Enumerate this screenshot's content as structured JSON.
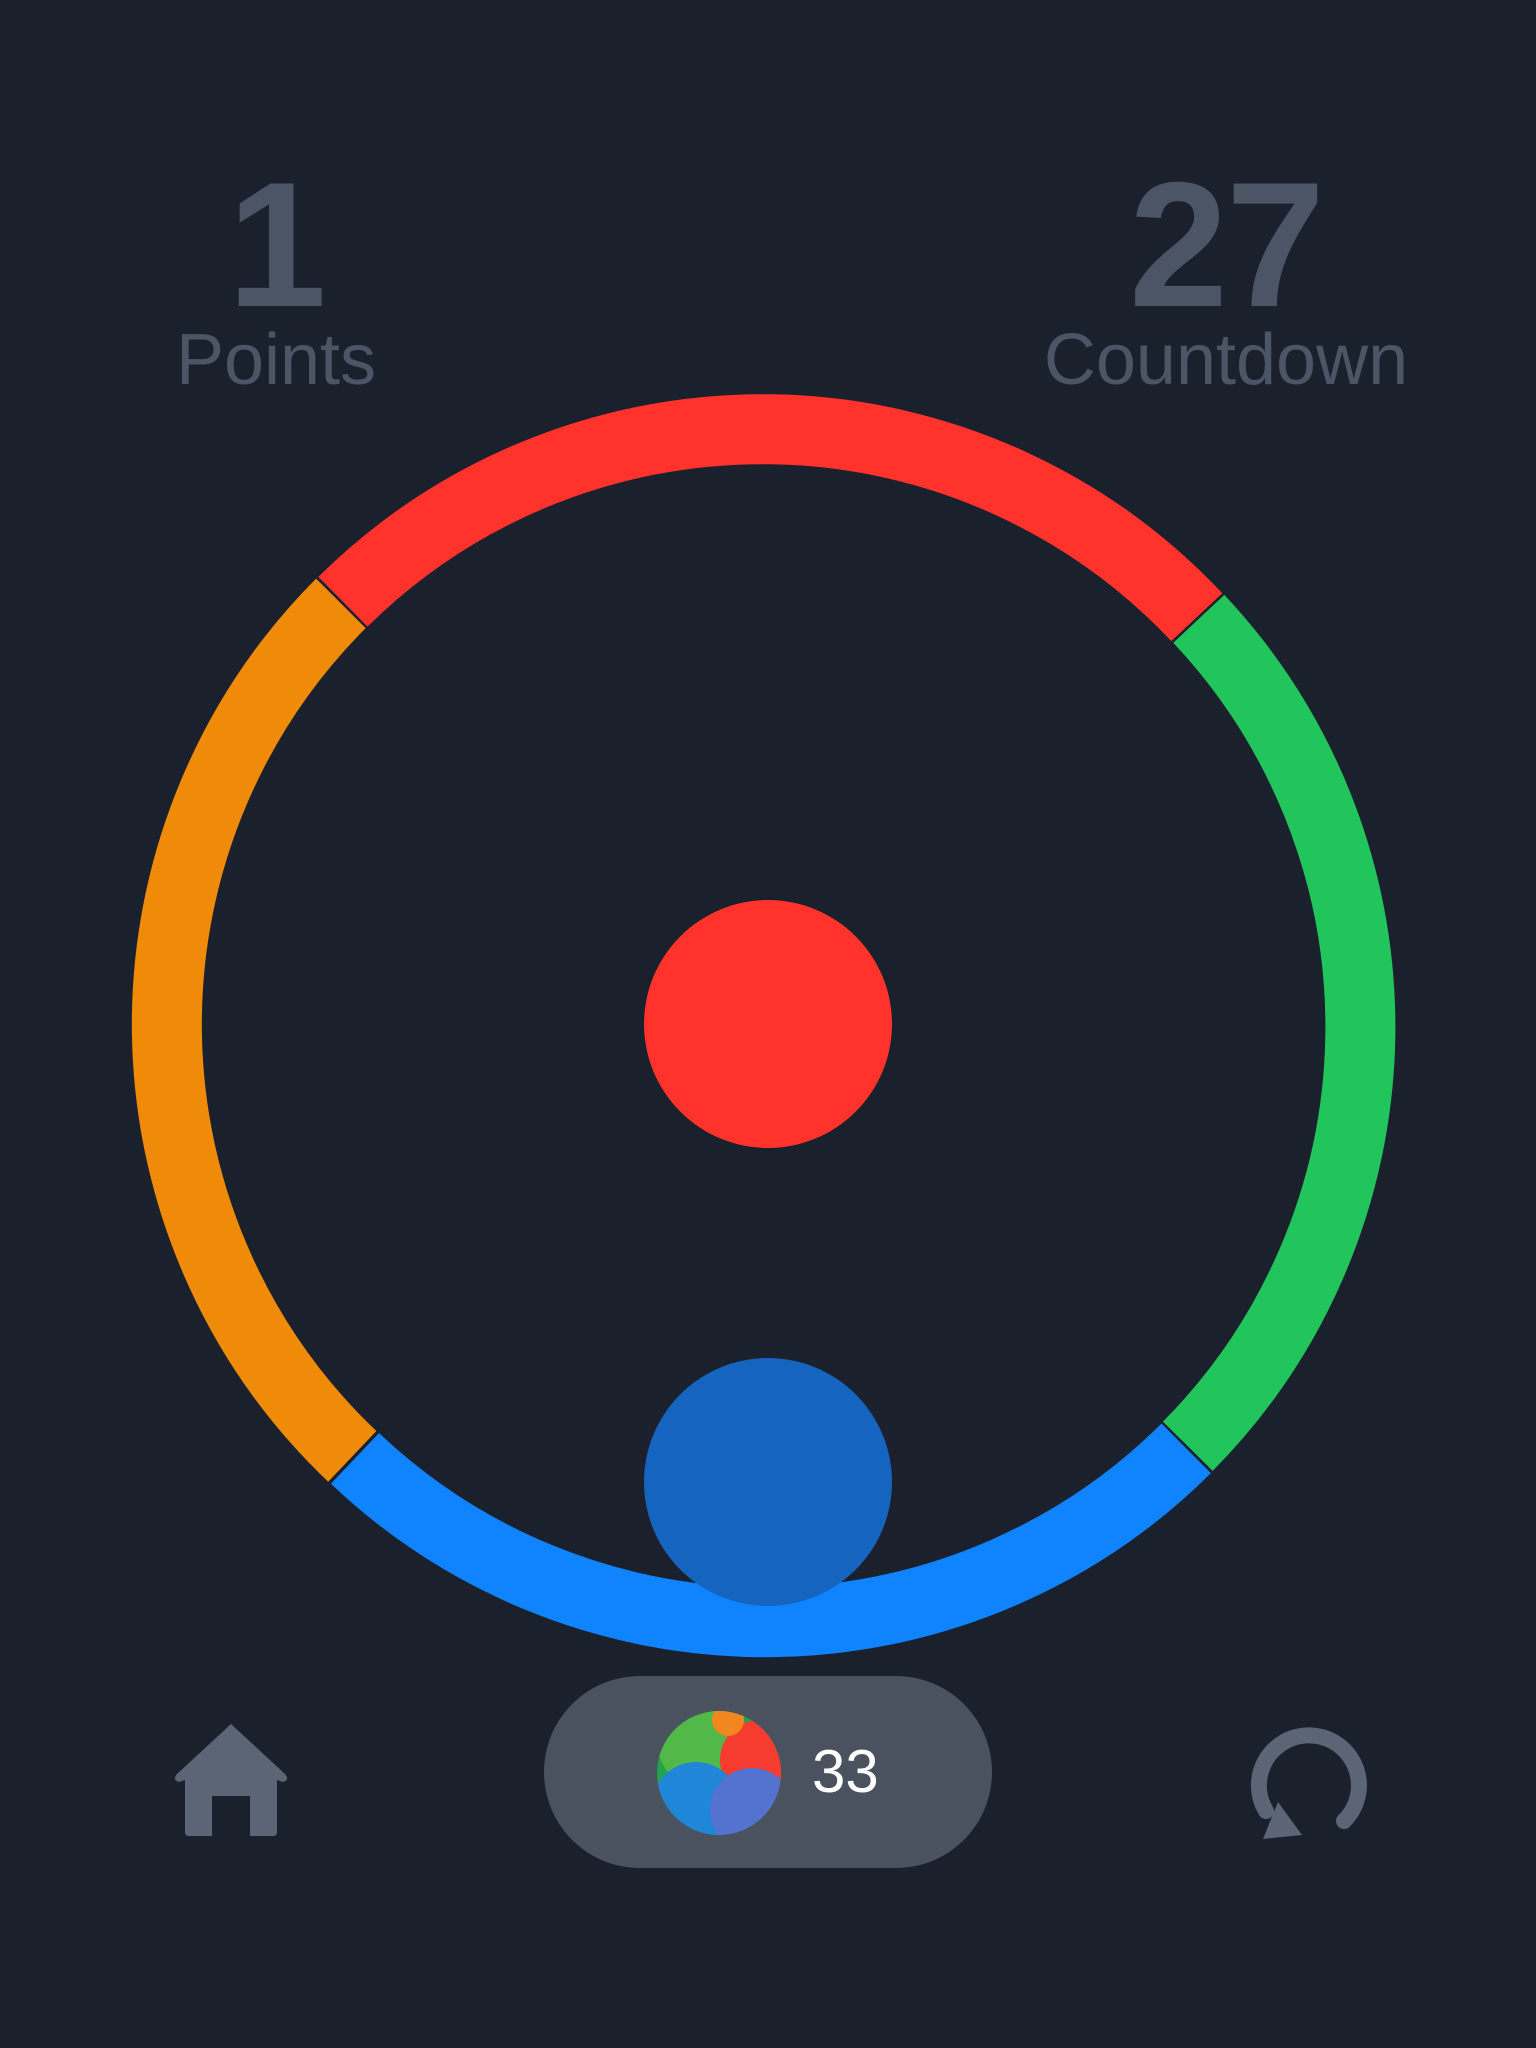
{
  "scoreboard": {
    "points_value": "1",
    "points_label": "Points",
    "countdown_value": "27",
    "countdown_label": "Countdown"
  },
  "ring": {
    "segments": [
      {
        "color": "#ff322c",
        "name": "red"
      },
      {
        "color": "#22c55c",
        "name": "green"
      },
      {
        "color": "#1083ff",
        "name": "blue"
      },
      {
        "color": "#f08b0a",
        "name": "orange"
      }
    ]
  },
  "target_ball": {
    "color": "#ff322c"
  },
  "player_ball": {
    "color": "#1565c0"
  },
  "balls_pill": {
    "count": "33",
    "icon": "multicolor-ball-icon"
  },
  "controls": {
    "home_icon": "home-icon",
    "restart_icon": "restart-icon"
  },
  "colors": {
    "background": "#1a212d",
    "text_muted": "#4c5565",
    "pill_background": "#4a5260",
    "icon_gray": "#5c6575"
  }
}
